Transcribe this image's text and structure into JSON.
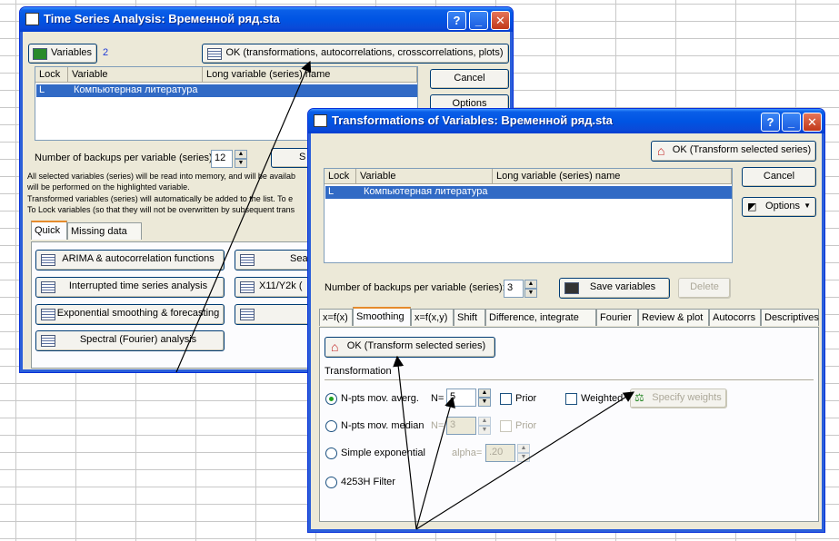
{
  "back_window": {
    "title": "Time Series Analysis: Временной ряд.sta",
    "variables_button": "Variables",
    "variables_count": "2",
    "ok_button": "OK (transformations, autocorrelations, crosscorrelations, plots)",
    "cancel_button": "Cancel",
    "options_button": "Options",
    "columns": [
      "Lock",
      "Variable",
      "Long variable (series) name"
    ],
    "rows": [
      {
        "lock": "L",
        "variable": "Компьютерная литература"
      }
    ],
    "backups_label": "Number of backups per variable (series):",
    "backups_value": "12",
    "save_button_partial": "S",
    "info_lines": [
      "All selected variables (series) will be read into memory, and will be availab",
      "will be performed on the highlighted variable.",
      "Transformed variables (series) will automatically be added to the list. To e",
      "To Lock variables (so that they will not be overwritten by subsequent trans"
    ],
    "tabs": [
      "Quick",
      "Missing data"
    ],
    "buttons_left": [
      "ARIMA & autocorrelation functions",
      "Interrupted time series analysis",
      "Exponential smoothing & forecasting",
      "Spectral (Fourier) analysis"
    ],
    "buttons_right": [
      "Seas",
      "X11/Y2k (",
      ""
    ]
  },
  "front_window": {
    "title": "Transformations of Variables: Временной ряд.sta",
    "ok_top_button": "OK (Transform selected series)",
    "cancel_button": "Cancel",
    "options_button": "Options",
    "columns": [
      "Lock",
      "Variable",
      "Long variable (series) name"
    ],
    "rows": [
      {
        "lock": "L",
        "variable": "Компьютерная литература"
      }
    ],
    "backups_label": "Number of backups per variable (series):",
    "backups_value": "3",
    "save_variables_button": "Save variables",
    "delete_button": "Delete",
    "tabs": [
      "x=f(x)",
      "Smoothing",
      "x=f(x,y)",
      "Shift",
      "Difference, integrate",
      "Fourier",
      "Review & plot",
      "Autocorrs",
      "Descriptives"
    ],
    "ok_inner_button": "OK (Transform selected series)",
    "transformation_label": "Transformation",
    "options": [
      {
        "label": "N-pts mov. averg.",
        "selected": true
      },
      {
        "label": "N-pts mov. median",
        "selected": false
      },
      {
        "label": "Simple exponential",
        "selected": false
      },
      {
        "label": "4253H Filter",
        "selected": false
      }
    ],
    "n_label": "N=",
    "n_value": "5",
    "n_value_disabled": "3",
    "prior_label": "Prior",
    "weighted_label": "Weighted",
    "specify_weights_button": "Specify weights",
    "alpha_label": "alpha=",
    "alpha_value": ".20"
  },
  "colors": {
    "titlebar": "#0054e3",
    "selection": "#316ac5",
    "window_bg": "#ece9d8"
  }
}
